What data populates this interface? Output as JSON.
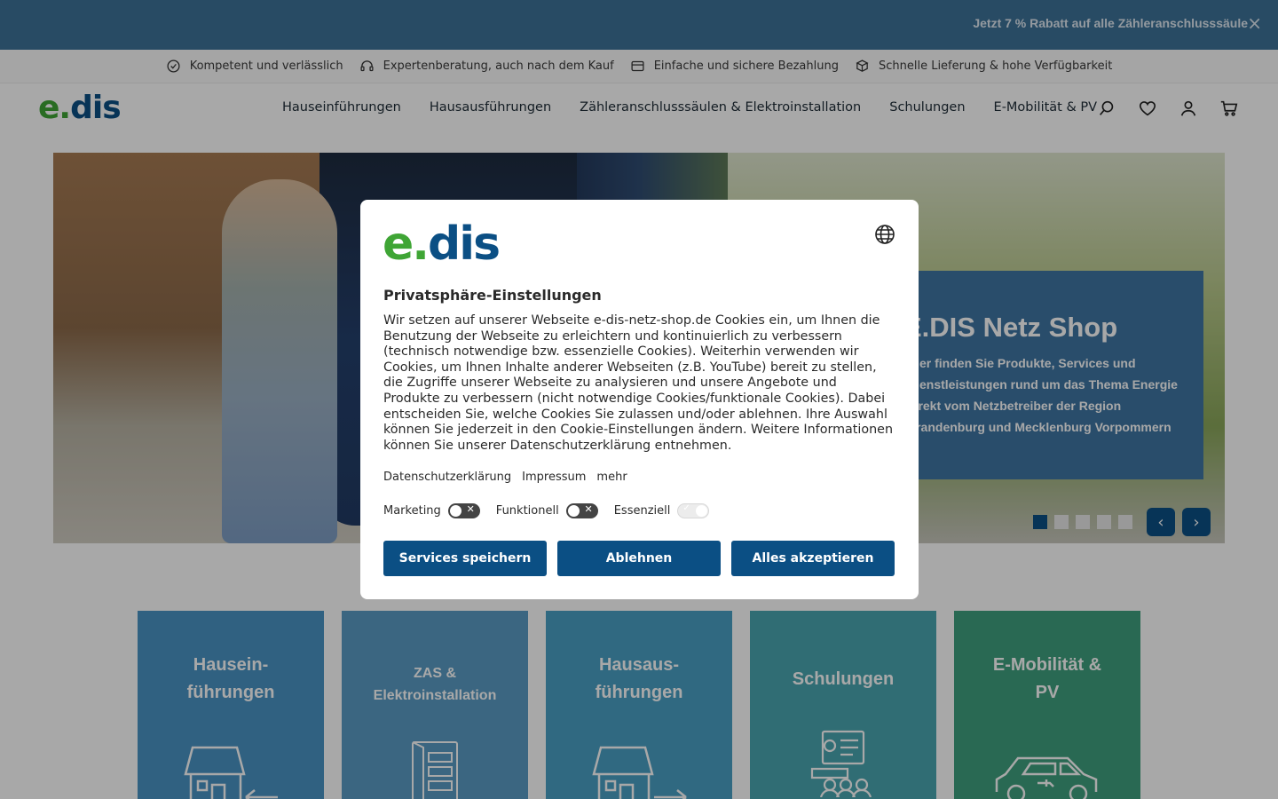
{
  "promo": {
    "text": "Jetzt 7 % Rabatt auf alle Zähleranschlusssäule",
    "close": "×"
  },
  "usp": [
    {
      "icon": "check-circle-icon",
      "label": "Kompetent und verlässlich"
    },
    {
      "icon": "headset-icon",
      "label": "Expertenberatung, auch nach dem Kauf"
    },
    {
      "icon": "credit-card-icon",
      "label": "Einfache und sichere Bezahlung"
    },
    {
      "icon": "package-icon",
      "label": "Schnelle Lieferung & hohe Verfügbarkeit"
    }
  ],
  "header": {
    "logo_green": "e.",
    "logo_blue": "dis",
    "nav": [
      "Hauseinführungen",
      "Hausausführungen",
      "Zähleranschlusssäulen & Elektroinstallation",
      "Schulungen",
      "E-Mobilität & PV"
    ]
  },
  "hero": {
    "title": "E.DIS Netz Shop",
    "text": "Hier finden Sie Produkte, Services und Dienstleistungen rund um das Thema Energie direkt vom Netzbetreiber der Region Brandenburg und Mecklenburg Vorpommern",
    "slide_count": 5,
    "active_slide": 1
  },
  "tiles": [
    {
      "label_1": "Hausein-",
      "label_2": "führungen",
      "color": "#4a94c4",
      "icon": "house-arrow-in-icon"
    },
    {
      "label_1": "ZAS &",
      "label_2": "Elektroinstallation",
      "color": "#5a9cc4",
      "icon": "meter-cabinet-icon"
    },
    {
      "label_1": "Hausaus-",
      "label_2": "führungen",
      "color": "#4aa0c4",
      "icon": "house-arrow-out-icon"
    },
    {
      "label_1": "Schulungen",
      "label_2": "",
      "color": "#4aa6b0",
      "icon": "training-icon"
    },
    {
      "label_1": "E-Mobilität &",
      "label_2": "PV",
      "color": "#3fa07e",
      "icon": "electric-car-icon"
    }
  ],
  "modal": {
    "logo_green": "e.",
    "logo_blue": "dis",
    "title": "Privatsphäre-Einstellungen",
    "body": "Wir setzen auf unserer Webseite e-dis-netz-shop.de Cookies ein, um Ihnen die Benutzung der Webseite zu erleichtern und kontinuierlich zu verbessern (technisch notwendige bzw. essenzielle Cookies). Weiterhin verwenden wir Cookies, um Ihnen Inhalte anderer Webseiten (z.B. YouTube) bereit zu stellen, die Zugriffe unserer Webseite zu analysieren und unsere Angebote und Produkte zu verbessern (nicht notwendige Cookies/funktionale Cookies). Dabei entscheiden Sie, welche Cookies Sie zulassen und/oder ablehnen. Ihre Auswahl können Sie jederzeit in den Cookie-Einstellungen ändern. Weitere Informationen können Sie unserer Datenschutzerklärung entnehmen.",
    "links": [
      "Datenschutzerklärung",
      "Impressum",
      "mehr"
    ],
    "toggles": [
      {
        "label": "Marketing",
        "on": false
      },
      {
        "label": "Funktionell",
        "on": false
      },
      {
        "label": "Essenziell",
        "on": true
      }
    ],
    "buttons": {
      "save": "Services speichern",
      "reject": "Ablehnen",
      "accept": "Alles akzeptieren"
    }
  },
  "colors": {
    "brand_blue": "#0b4f84",
    "brand_green": "#3fa535",
    "promo_bg": "#3d7298"
  }
}
